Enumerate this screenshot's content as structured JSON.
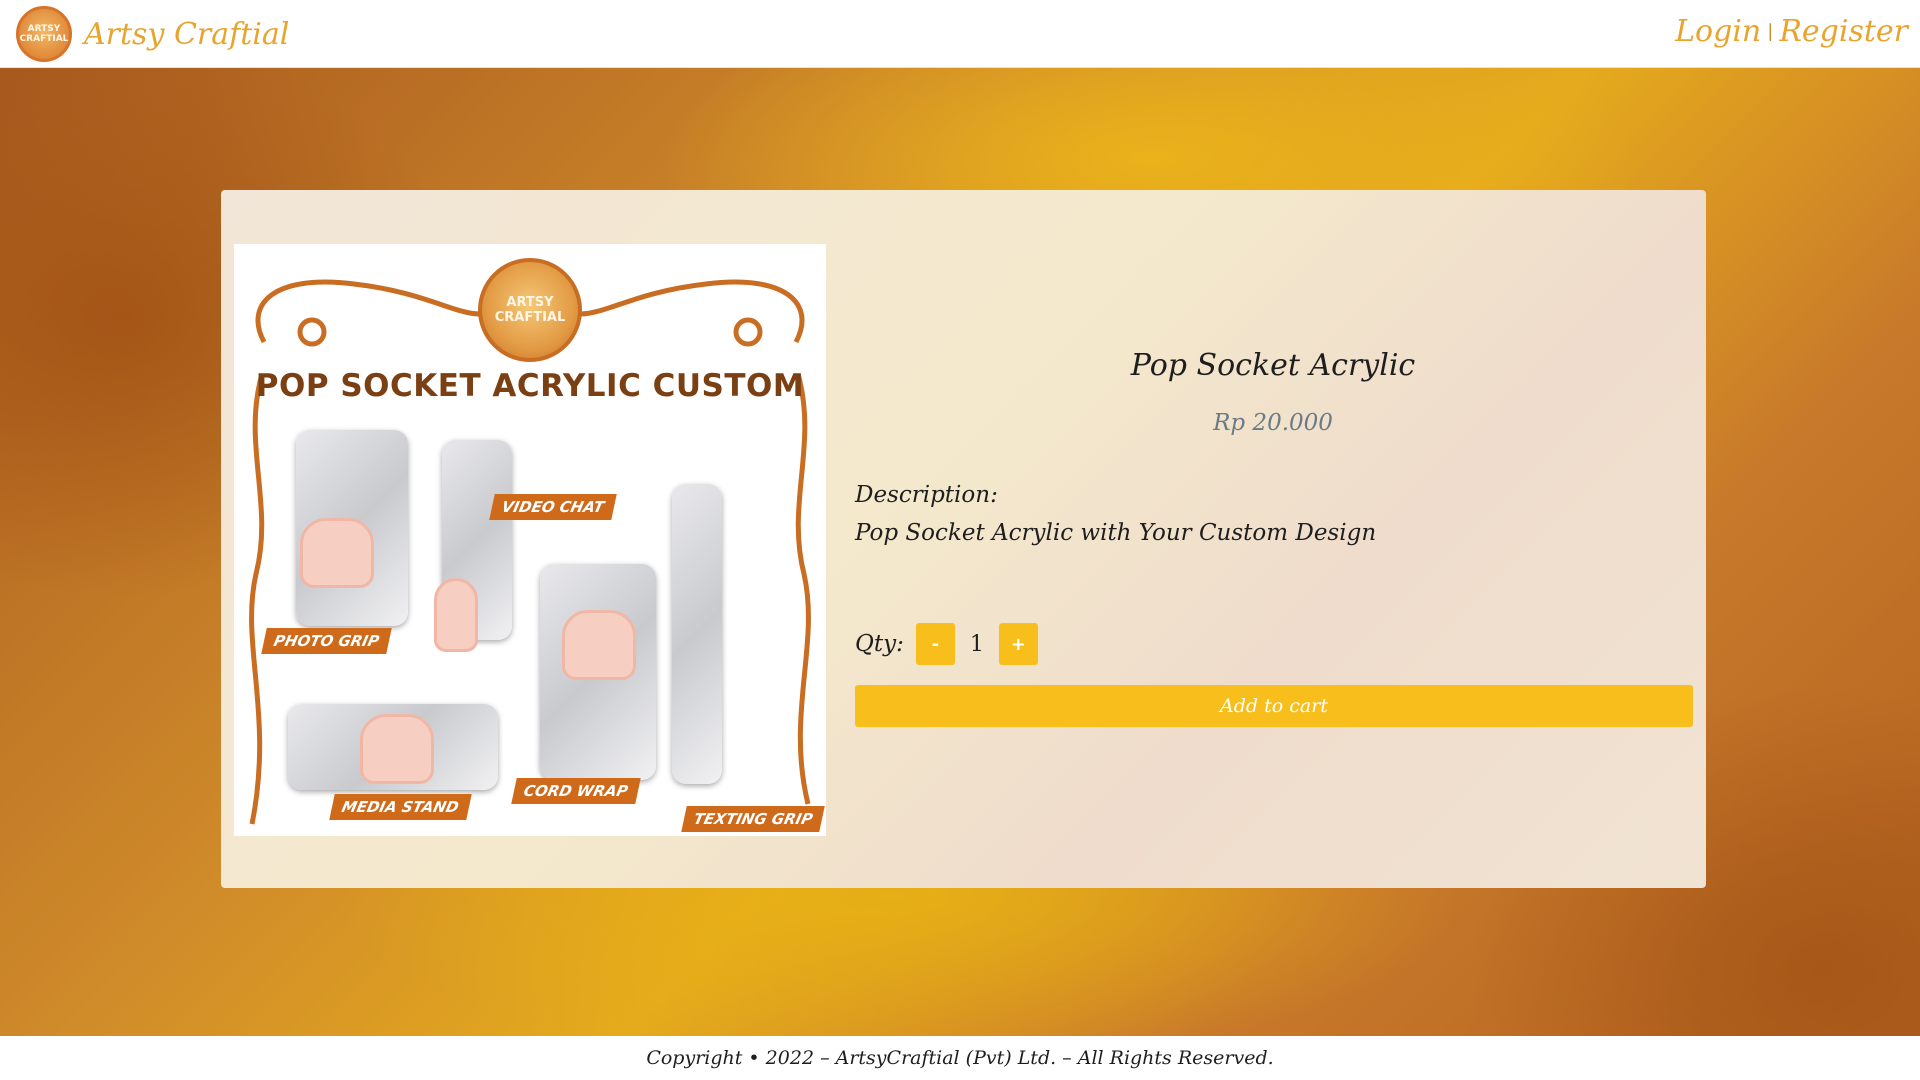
{
  "header": {
    "brand_name": "Artsy Craftial",
    "logo_text": "ARTSY CRAFTIAL",
    "login": "Login",
    "separator": "|",
    "register": "Register"
  },
  "product": {
    "title": "Pop Socket Acrylic",
    "price": "Rp 20.000",
    "description_label": "Description:",
    "description": "Pop Socket Acrylic with Your Custom Design",
    "qty_label": "Qty:",
    "qty_value": "1",
    "minus_label": "-",
    "plus_label": "+",
    "add_to_cart": "Add to cart"
  },
  "product_image": {
    "seal_text": "ARTSY CRAFTIAL",
    "title": "POP SOCKET ACRYLIC CUSTOM",
    "tags": [
      "VIDEO CHAT",
      "PHOTO GRIP",
      "MEDIA STAND",
      "CORD WRAP",
      "TEXTING GRIP"
    ]
  },
  "footer": {
    "copyright": "Copyright • 2022 – ArtsyCraftial (Pvt) Ltd. – All Rights Reserved."
  },
  "colors": {
    "accent": "#f8bf1c",
    "brand_text": "#e9a42e",
    "price_text": "#6b7b85"
  }
}
